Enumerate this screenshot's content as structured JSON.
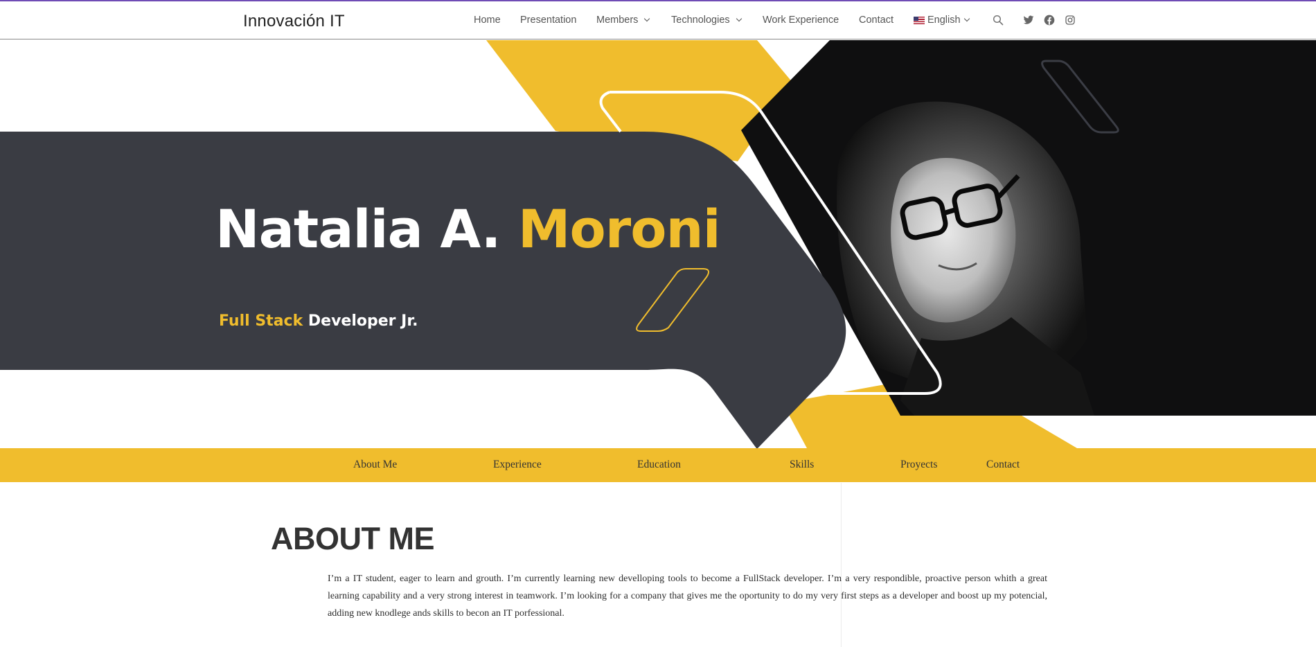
{
  "header": {
    "brand": "Innovación IT",
    "nav": [
      {
        "label": "Home"
      },
      {
        "label": "Presentation"
      },
      {
        "label": "Members"
      },
      {
        "label": "Technologies"
      },
      {
        "label": "Work Experience"
      },
      {
        "label": "Contact"
      },
      {
        "label": "English"
      }
    ],
    "icons": [
      "search-icon",
      "twitter-icon",
      "facebook-icon",
      "instagram-icon"
    ]
  },
  "hero": {
    "first_name": "Natalia A.",
    "last_name": "Moroni",
    "subtitle_highlight": "Full Stack",
    "subtitle_rest": "Developer Jr."
  },
  "section_nav": [
    {
      "label": "About Me"
    },
    {
      "label": "Experience"
    },
    {
      "label": "Education"
    },
    {
      "label": "Skills"
    },
    {
      "label": "Proyects"
    },
    {
      "label": "Contact"
    }
  ],
  "about": {
    "title": "ABOUT ME",
    "text": "I’m a IT student, eager to learn and grouth.  I’m currently  learning new  develloping tools to become a FullStack developer. I’m a very respondible, proactive person whith a great learning capability and a very strong interest in teamwork. I’m looking for a company that gives me the oportunity  to do my very first steps as a developer and boost up my potencial, adding new knodlege ands skills to becon an IT porfessional."
  },
  "colors": {
    "accent": "#f0bd2d",
    "dark_panel": "#3a3c43",
    "black_panel": "#0f0f10",
    "top_line": "#6f4bb5"
  }
}
